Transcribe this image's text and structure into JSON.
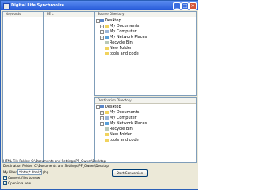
{
  "window": {
    "title": "Digital Life Synchronize"
  },
  "left_list": {
    "header": "Keywords"
  },
  "mid_list": {
    "header": "PE L"
  },
  "source": {
    "header": "Source Directory",
    "items": [
      "Desktop",
      "My Documents",
      "My Computer",
      "My Network Places",
      "Recycle Bin",
      "New Folder",
      "tools and code"
    ]
  },
  "destination": {
    "header": "Destination Directory",
    "items": [
      "Desktop",
      "My Documents",
      "My Computer",
      "My Network Places",
      "Recycle Bin",
      "New Folder",
      "tools and code"
    ]
  },
  "bottom": {
    "html_filter_line": "HTML File Folder: C:\\Documents and Settings\\PF_Owner\\Desktop",
    "dest_line": "Destination Folder: C:\\Documents and Settings\\PF_Owner\\Desktop",
    "my_filter_label": "My Filter:",
    "my_filter_value": "*.htm;*.html;*.php",
    "checkbox1_label": "Convert files to new",
    "checkbox2_label": "Open in a new",
    "start_label": "Start Conversion"
  },
  "colors": {
    "titlebar": "#2659d8",
    "folder": "#f1d35e",
    "window_bg": "#ece9d8"
  }
}
